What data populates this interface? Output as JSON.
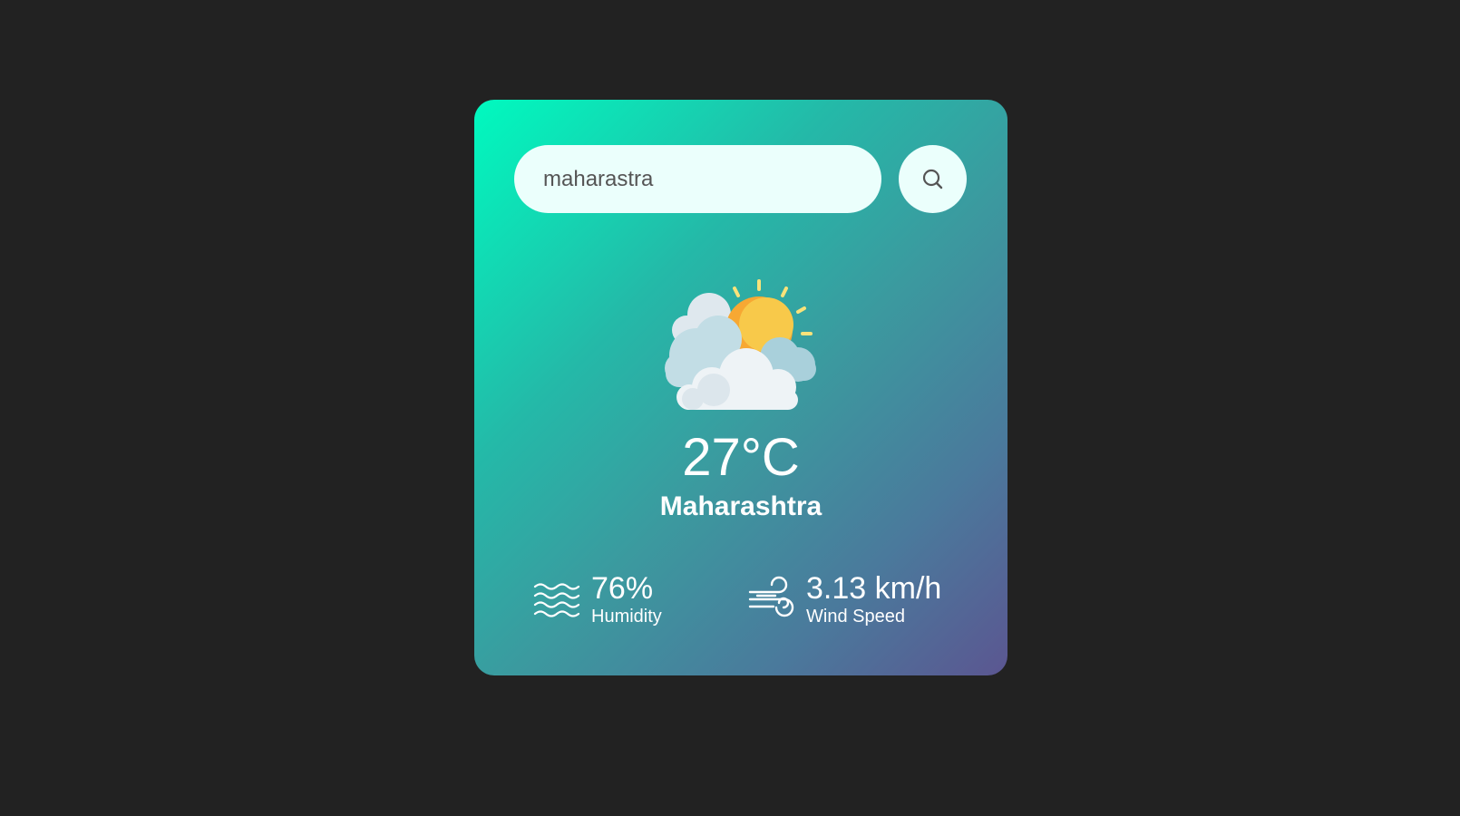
{
  "search": {
    "value": "maharastra"
  },
  "weather": {
    "condition_icon": "partly-cloudy-icon",
    "temperature": "27°C",
    "city": "Maharashtra"
  },
  "details": {
    "humidity": {
      "icon": "humidity-waves-icon",
      "value": "76%",
      "label": "Humidity"
    },
    "wind": {
      "icon": "wind-icon",
      "value": "3.13 km/h",
      "label": "Wind Speed"
    }
  },
  "colors": {
    "page_background": "#222222",
    "gradient_start": "#00fabf",
    "gradient_end": "#5b5691",
    "input_background": "#ebfffc",
    "sun": "#f7b733",
    "sun_rays": "#f9e27a",
    "cloud": "#eef3f6"
  }
}
